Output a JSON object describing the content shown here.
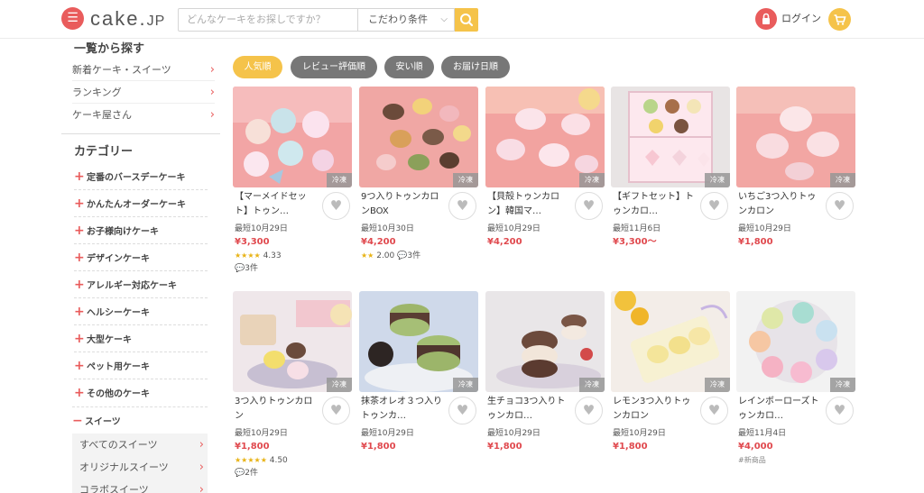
{
  "header": {
    "logo_text": "cake.",
    "logo_suffix": "JP",
    "search_placeholder": "どんなケーキをお探しですか？",
    "filter_label": "こだわり条件",
    "login_label": "ログイン",
    "colors": {
      "accent_red": "#e95c5c",
      "accent_yellow": "#f5c34a"
    }
  },
  "sidebar": {
    "browse_title": "一覧から探す",
    "browse_links": [
      {
        "label": "新着ケーキ・スイーツ"
      },
      {
        "label": "ランキング"
      },
      {
        "label": "ケーキ屋さん"
      }
    ],
    "category_title": "カテゴリー",
    "categories": [
      {
        "label": "定番のバースデーケーキ"
      },
      {
        "label": "かんたんオーダーケーキ"
      },
      {
        "label": "お子様向けケーキ"
      },
      {
        "label": "デザインケーキ"
      },
      {
        "label": "アレルギー対応ケーキ"
      },
      {
        "label": "ヘルシーケーキ"
      },
      {
        "label": "大型ケーキ"
      },
      {
        "label": "ペット用ケーキ"
      },
      {
        "label": "その他のケーキ"
      }
    ],
    "sweets_label": "スイーツ",
    "sweets_links": [
      {
        "label": "すべてのスイーツ"
      },
      {
        "label": "オリジナルスイーツ"
      },
      {
        "label": "コラボスイーツ"
      }
    ]
  },
  "sort": {
    "options": [
      {
        "label": "人気順",
        "active": true
      },
      {
        "label": "レビュー評価順",
        "active": false
      },
      {
        "label": "安い順",
        "active": false
      },
      {
        "label": "お届け日順",
        "active": false
      }
    ]
  },
  "products": [
    {
      "name": "【マーメイドセット】トゥン…",
      "date": "最短10月29日",
      "price": "¥3,300",
      "stars": "★★★★",
      "rating": "4.33",
      "reviews": "3件",
      "badge": "冷凍"
    },
    {
      "name": "9つ入りトゥンカロンBOX",
      "date": "最短10月30日",
      "price": "¥4,200",
      "stars": "★★",
      "rating": "2.00",
      "reviews": "3件",
      "badge": "冷凍"
    },
    {
      "name": "【貝殻トゥンカロン】韓国マ…",
      "date": "最短10月29日",
      "price": "¥4,200",
      "badge": "冷凍"
    },
    {
      "name": "【ギフトセット】トゥンカロ…",
      "date": "最短11月6日",
      "price": "¥3,300～",
      "badge": "冷凍"
    },
    {
      "name": "いちご3つ入りトゥンカロン",
      "date": "最短10月29日",
      "price": "¥1,800",
      "badge": "冷凍"
    },
    {
      "name": "3つ入りトゥンカロン",
      "date": "最短10月29日",
      "price": "¥1,800",
      "stars": "★★★★★",
      "rating": "4.50",
      "reviews": "2件",
      "badge": "冷凍"
    },
    {
      "name": "抹茶オレオ３つ入りトゥンカ…",
      "date": "最短10月29日",
      "price": "¥1,800",
      "badge": "冷凍"
    },
    {
      "name": "生チョコ3つ入りトゥンカロ…",
      "date": "最短10月29日",
      "price": "¥1,800",
      "badge": "冷凍"
    },
    {
      "name": "レモン3つ入りトゥンカロン",
      "date": "最短10月29日",
      "price": "¥1,800",
      "badge": "冷凍"
    },
    {
      "name": "レインボーローズトゥンカロ…",
      "date": "最短11月4日",
      "price": "¥4,000",
      "tag": "#新商品",
      "badge": "冷凍"
    }
  ]
}
